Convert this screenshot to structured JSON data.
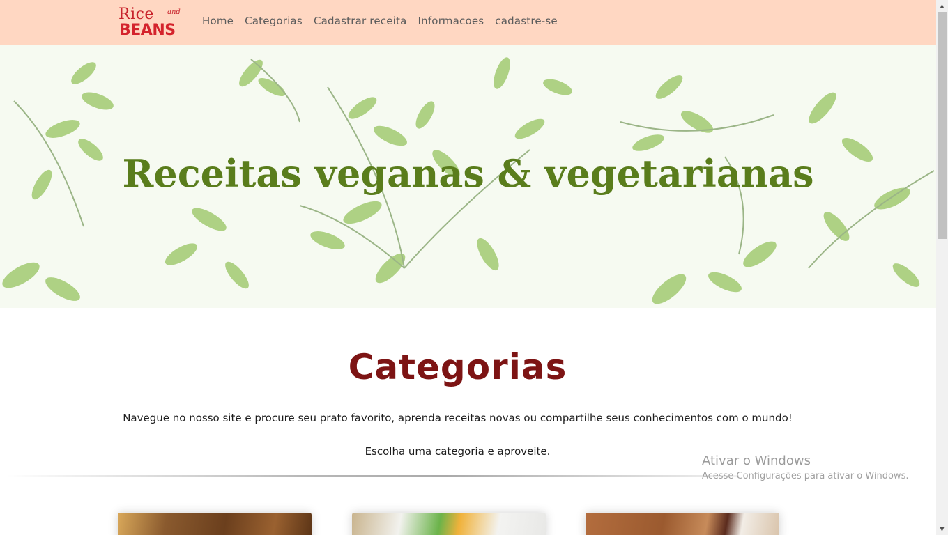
{
  "navbar": {
    "logo": {
      "line1": "Rice",
      "small": "and",
      "line2": "BEANS"
    },
    "links": [
      "Home",
      "Categorias",
      "Cadastrar receita",
      "Informacoes",
      "cadastre-se"
    ]
  },
  "hero": {
    "title": "Receitas veganas & vegetarianas"
  },
  "categories_section": {
    "title": "Categorias",
    "lead": "Navegue no nosso site e procure seu prato favorito, aprenda receitas novas ou compartilhe seus conhecimentos com o mundo!",
    "sublead": "Escolha uma categoria e aproveite."
  },
  "watermark": {
    "title": "Ativar o Windows",
    "subtitle": "Acesse Configurações para ativar o Windows."
  },
  "scrollbar": {
    "up_glyph": "▲",
    "down_glyph": "▼"
  },
  "colors": {
    "navbar_bg": "#ffd7c2",
    "brand_red": "#c8232c",
    "hero_title": "#5a7d1c",
    "section_title": "#7d1414",
    "leaf_green": "#9bc46a"
  }
}
